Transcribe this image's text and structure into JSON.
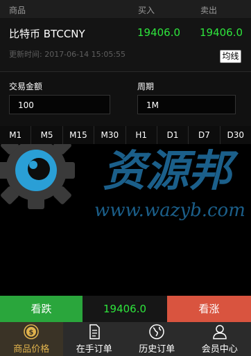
{
  "header": {
    "product": "商品",
    "buy": "买入",
    "sell": "卖出"
  },
  "quote": {
    "symbol": "比特币 BTCCNY",
    "buy_price": "19406.0",
    "sell_price": "19406.0",
    "updated": "更新时间: 2017-06-14 15:05:55",
    "ma_button": "均线"
  },
  "form": {
    "amount_label": "交易金额",
    "amount_value": "100",
    "period_label": "周期",
    "period_value": "1M"
  },
  "timeframes": [
    "M1",
    "M5",
    "M15",
    "M30",
    "H1",
    "D1",
    "D7",
    "D30"
  ],
  "watermark": {
    "title": "资源邦",
    "url": "www.wazyb.com"
  },
  "actions": {
    "down_label": "看跌",
    "current_price": "19406.0",
    "up_label": "看涨"
  },
  "tabs": [
    {
      "label": "商品价格",
      "icon": "coin-icon"
    },
    {
      "label": "在手订单",
      "icon": "document-icon"
    },
    {
      "label": "历史订单",
      "icon": "globe-icon"
    },
    {
      "label": "会员中心",
      "icon": "user-icon"
    }
  ],
  "colors": {
    "price_green": "#2ee53c",
    "down_button": "#2aa63c",
    "up_button": "#d9543f",
    "active_tab": "#e0b34d"
  }
}
